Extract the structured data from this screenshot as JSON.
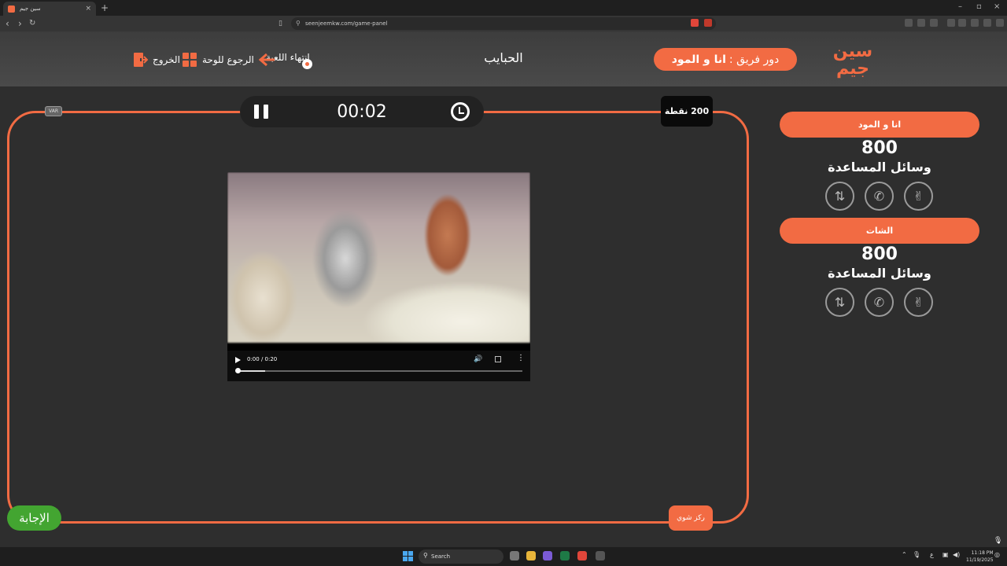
{
  "browser": {
    "tab_title": "سين جيم",
    "tab_close": "×",
    "new_tab": "+",
    "url": "seenjeemkw.com/game-panel",
    "window_controls": [
      "–",
      "▫",
      "×"
    ]
  },
  "header": {
    "logo_line1": "سين",
    "logo_line2": "جيم",
    "turn_prefix": "دور فريق :",
    "turn_team": "انا و المود",
    "category": "الحبايب",
    "end_game_label": "انتهاء اللعبة",
    "back_to_board_label": "الرجوع للوحة",
    "exit_label": "الخروج"
  },
  "stage": {
    "timer": "00:02",
    "points": "200 نقطة",
    "var_label": "VAR",
    "answer_label": "الإجابة",
    "focus_label": "ركز شوي",
    "video": {
      "time": "0:00 / 0:20",
      "progress": 0.0
    }
  },
  "teams": [
    {
      "name": "انا و المود",
      "score": "800",
      "help_label": "وسائل المساعدة",
      "help_icons": [
        "peace-hand-icon",
        "phone-icon",
        "swap-icon"
      ]
    },
    {
      "name": "الشات",
      "score": "800",
      "help_label": "وسائل المساعدة",
      "help_icons": [
        "peace-hand-icon",
        "phone-icon",
        "swap-icon"
      ]
    }
  ],
  "taskbar": {
    "search_placeholder": "Search",
    "lang": "ع",
    "time": "11:18 PM",
    "date": "11/19/2025"
  },
  "colors": {
    "accent": "#f26b43",
    "answer_green": "#43a531",
    "background": "#2e2e2e"
  }
}
